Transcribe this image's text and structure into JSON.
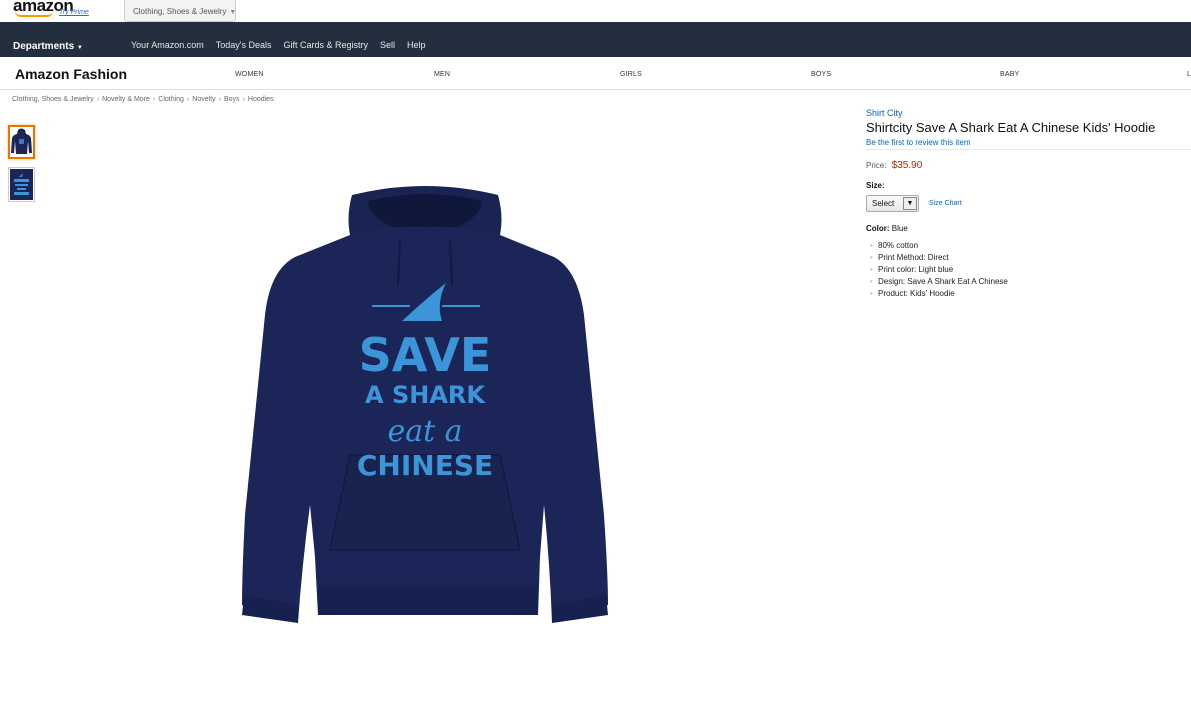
{
  "header": {
    "logo_text": "amazon",
    "prime_text": "Try Prime",
    "search_department": "Clothing, Shoes & Jewelry"
  },
  "nav": {
    "departments_label": "Departments",
    "links": [
      "Your Amazon.com",
      "Today's Deals",
      "Gift Cards & Registry",
      "Sell",
      "Help"
    ]
  },
  "subnav": {
    "title": "Amazon Fashion",
    "items": [
      "WOMEN",
      "MEN",
      "GIRLS",
      "BOYS",
      "BABY",
      "L"
    ]
  },
  "breadcrumb": [
    "Clothing, Shoes & Jewelry",
    "Novelty & More",
    "Clothing",
    "Novelty",
    "Boys",
    "Hoodies"
  ],
  "product": {
    "brand": "Shirt City",
    "title": "Shirtcity Save A Shark Eat A Chinese Kids' Hoodie",
    "review_link": "Be the first to review this item",
    "price_label": "Price:",
    "price": "$35.90",
    "size_label": "Size:",
    "size_select": "Select",
    "size_chart_link": "Size Chart",
    "color_label": "Color:",
    "color_value": "Blue",
    "bullets": [
      "80% cotton",
      "Print Method: Direct",
      "Print color: Light blue",
      "Design: Save A Shark Eat A Chinese",
      "Product: Kids' Hoodie"
    ]
  },
  "image_print": {
    "line1": "SAVE",
    "line2": "A SHARK",
    "line3": "eat a",
    "line4": "CHINESE"
  },
  "colors": {
    "nav_bg": "#232f3e",
    "hoodie": "#1b2558",
    "print": "#3b95d8",
    "price": "#b12704",
    "link": "#0066c0",
    "thumb_selected": "#e77600"
  }
}
